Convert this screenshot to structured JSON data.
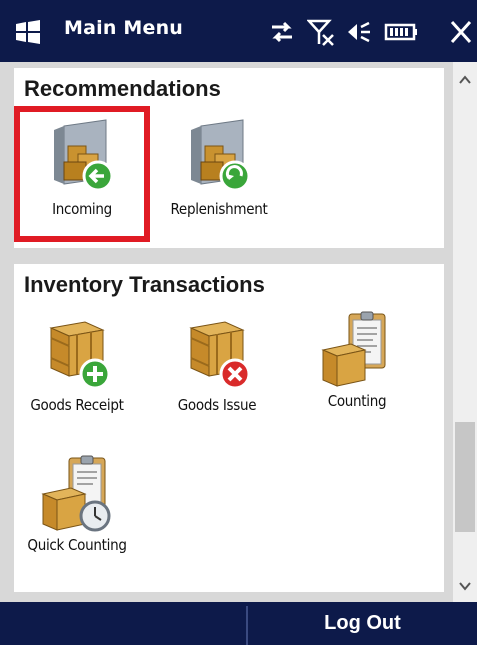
{
  "titlebar": {
    "title": "Main Menu",
    "logo_icon": "windows-flag-icon",
    "status_icons": [
      "network-sync-icon",
      "signal-off-icon",
      "volume-icon",
      "battery-icon",
      "close-icon"
    ]
  },
  "recommendations": {
    "heading": "Recommendations",
    "items": [
      {
        "label": "Incoming",
        "icon": "incoming-icon",
        "selected": true
      },
      {
        "label": "Replenishment",
        "icon": "replenishment-icon",
        "selected": false
      }
    ]
  },
  "inventory": {
    "heading": "Inventory Transactions",
    "items": [
      {
        "label": "Goods Receipt",
        "icon": "goods-receipt-icon"
      },
      {
        "label": "Goods Issue",
        "icon": "goods-issue-icon"
      },
      {
        "label": "Counting",
        "icon": "counting-icon"
      },
      {
        "label": "Quick Counting",
        "icon": "quick-counting-icon"
      }
    ]
  },
  "softkeys": {
    "left": "",
    "right": "Log Out"
  },
  "colors": {
    "bar": "#0d1a4a",
    "selection": "#e01b24"
  }
}
